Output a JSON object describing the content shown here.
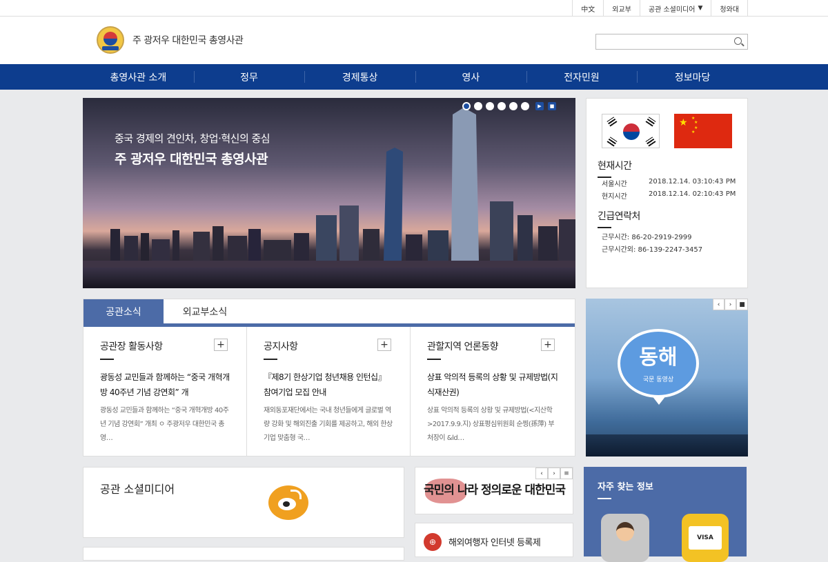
{
  "topbar": {
    "links": [
      "中文",
      "외교부",
      "공관 소셜미디어",
      "청와대"
    ]
  },
  "header": {
    "title": "주 광저우 대한민국 총영사관",
    "search_placeholder": ""
  },
  "nav": {
    "items": [
      "총영사관 소개",
      "정무",
      "경제통상",
      "영사",
      "전자민원",
      "정보마당"
    ]
  },
  "banner": {
    "line1": "중국 경제의 견인차, 창업·혁신의 중심",
    "line2": "주 광저우 대한민국 총영사관",
    "play": "▶",
    "stop": "■"
  },
  "info": {
    "time_title": "현재시간",
    "seoul_label": "서울시간",
    "seoul_time": "2018.12.14. 03:10:43 PM",
    "local_label": "현지시간",
    "local_time": "2018.12.14. 02:10:43 PM",
    "contact_title": "긴급연락처",
    "work_hours": "근무시간: 86-20-2919-2999",
    "after_hours": "근무시간외: 86-139-2247-3457"
  },
  "news": {
    "tabs": [
      "공관소식",
      "외교부소식"
    ],
    "columns": [
      {
        "title": "공관장 활동사항",
        "headline": "광동성 교민들과 함께하는 “중국 개혁개방 40주년 기념 강연회” 개",
        "body": "광동성 교민들과 함께하는 “중국 개혁개방 40주년 기념 강연회” 개최 ㅇ 주광저우 대한민국 총영…"
      },
      {
        "title": "공지사항",
        "headline": "『제8기 한상기업 청년채용 인턴십』 참여기업 모집 안내",
        "body": "재외동포재단에서는 국내 청년들에게 글로벌 역량 강화 및 해외진출 기회를 제공하고, 해외 한상기업 맞춤형 국…"
      },
      {
        "title": "관할지역 언론동향",
        "headline": "상표 악의적 등록의 상황 및 규제방법(지식재산권)",
        "body": "상표 악의적 등록의 상황 및 규제방법(<지산학>2017.9.9.지) 상표평심위원회 순찡(孫萍) 부처장이 &ld…"
      }
    ],
    "plus": "+"
  },
  "video": {
    "title": "동해",
    "subtitle": "국문 동영상",
    "prev": "‹",
    "next": "›",
    "stop": "■"
  },
  "social": {
    "title": "공관 소셜미디어"
  },
  "promo": {
    "text": "국민의 나라 정의로운 대한민국",
    "prev": "‹",
    "next": "›",
    "menu": "≡"
  },
  "register": {
    "label": "해외여행자 인터넷 등록제",
    "icon": "⊕"
  },
  "freq": {
    "title": "자주 찾는 정보",
    "visa": "VISA"
  }
}
